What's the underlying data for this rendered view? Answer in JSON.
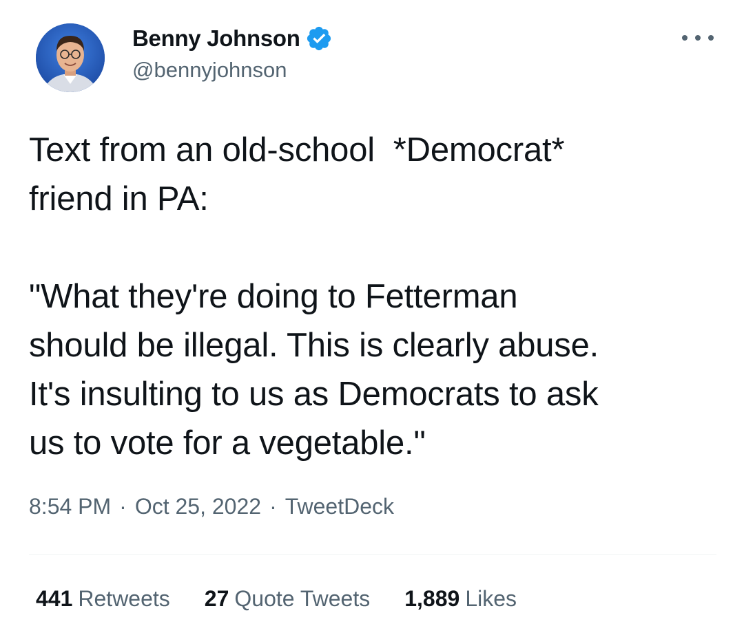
{
  "author": {
    "display_name": "Benny Johnson",
    "handle": "@bennyjohnson",
    "verified": true,
    "verified_color": "#1d9bf0"
  },
  "icons": {
    "verified": "verified-badge-icon",
    "more": "more-options-icon"
  },
  "tweet": {
    "text": "Text from an old-school  *Democrat*\nfriend in PA:\n\n\"What they're doing to Fetterman\nshould be illegal. This is clearly abuse.\nIt's insulting to us as Democrats to ask\nus to vote for a vegetable.\"",
    "time": "8:54 PM",
    "separator": "·",
    "date": "Oct 25, 2022",
    "source": "TweetDeck"
  },
  "stats": {
    "retweets_count": "441",
    "retweets_label": "Retweets",
    "quote_count": "27",
    "quote_label": "Quote Tweets",
    "likes_count": "1,889",
    "likes_label": "Likes"
  },
  "colors": {
    "text_primary": "#0f1419",
    "text_secondary": "#536471",
    "divider": "#eff3f4"
  }
}
